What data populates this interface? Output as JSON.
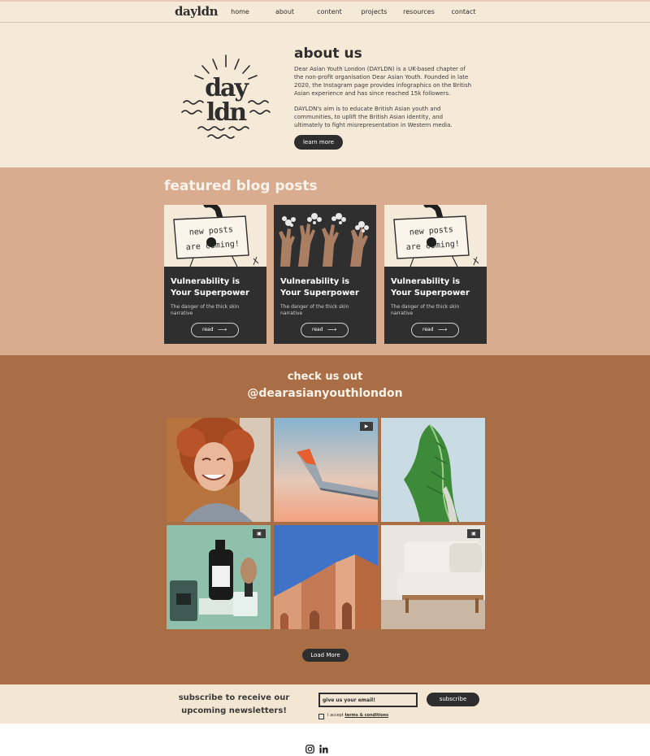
{
  "nav": {
    "logo": "dayldn",
    "links": [
      "home",
      "about",
      "content",
      "projects",
      "resources",
      "contact"
    ]
  },
  "about": {
    "logo_top": "day",
    "logo_bottom": "ldn",
    "title": "about us",
    "paragraph1": "Dear Asian Youth London (DAYLDN) is a UK-based chapter of the non-profit organisation Dear Asian Youth. Founded in late 2020, the Instagram page provides infographics on the British Asian experience and has since reached 15k followers.",
    "paragraph2": "DAYLDN's aim is to educate British Asian youth and communities, to uplift the British Asian identity, and ultimately to fight misrepresentation in Western media.",
    "button": "learn more"
  },
  "blog": {
    "title": "featured blog posts",
    "posts": [
      {
        "title": "Vulnerability is Your Superpower",
        "subtitle": "The danger of the thick skin narrative",
        "button": "read",
        "sign_top": "new posts",
        "sign_bottom": "are coming!"
      },
      {
        "title": "Vulnerability is Your Superpower",
        "subtitle": "The danger of the thick skin narrative",
        "button": "read"
      },
      {
        "title": "Vulnerability is Your Superpower",
        "subtitle": "The danger of the thick skin narrative",
        "button": "read",
        "sign_top": "new posts",
        "sign_bottom": "are coming!"
      }
    ]
  },
  "instagram": {
    "title": "check us out",
    "handle": "@dearasianyouthlondon",
    "tiles": [
      "woman-laughing",
      "airplane-wing",
      "green-leaf",
      "bottles-and-brush",
      "terracotta-building",
      "white-sofa"
    ],
    "load_more": "Load More"
  },
  "subscribe": {
    "title": "subscribe to receive our upcoming newsletters!",
    "email_placeholder": "give us your email!",
    "button": "subscribe",
    "terms_prefix": "I accept ",
    "terms_link": "terms & conditions"
  },
  "footer": {
    "icons": [
      "instagram-icon",
      "linkedin-icon"
    ]
  },
  "colors": {
    "cream": "#f5e9d8",
    "peach": "#d9ac8f",
    "terracotta": "#aa6e46",
    "dark": "#2e2e2e"
  }
}
